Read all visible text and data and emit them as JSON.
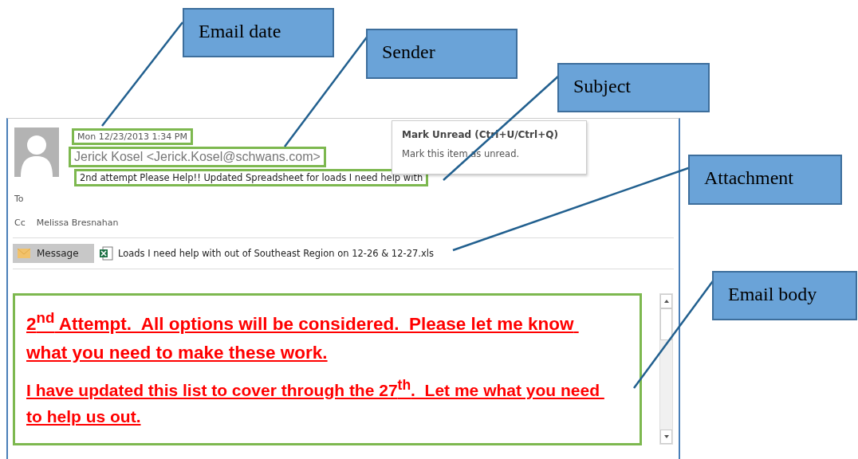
{
  "callouts": [
    {
      "label": "Email date"
    },
    {
      "label": "Sender"
    },
    {
      "label": "Subject"
    },
    {
      "label": "Attachment"
    },
    {
      "label": "Email body"
    }
  ],
  "message": {
    "date": "Mon 12/23/2013 1:34 PM",
    "sender": "Jerick Kosel <Jerick.Kosel@schwans.com>",
    "subject": "2nd attempt Please Help!! Updated Spreadsheet for loads I need help with",
    "to_label": "To",
    "cc_label": "Cc",
    "cc": "Melissa Bresnahan",
    "tabs": [
      {
        "label": "Message",
        "selected": true
      }
    ],
    "attachment": "Loads I need help with out of Southeast Region on 12-26 & 12-27.xls",
    "body": [
      {
        "text": "2$^{nd}$ Attempt.  All options will be considered.  Please let me know what you need to make these work.",
        "kind": "large"
      },
      {
        "text": "I have updated this list to cover through the 27$^{th}$.  Let me what you need to help us out.",
        "kind": "normal"
      }
    ]
  },
  "tooltip": {
    "title": "Mark Unread (Ctrl+U/Ctrl+Q)",
    "text": "Mark this item as unread."
  }
}
